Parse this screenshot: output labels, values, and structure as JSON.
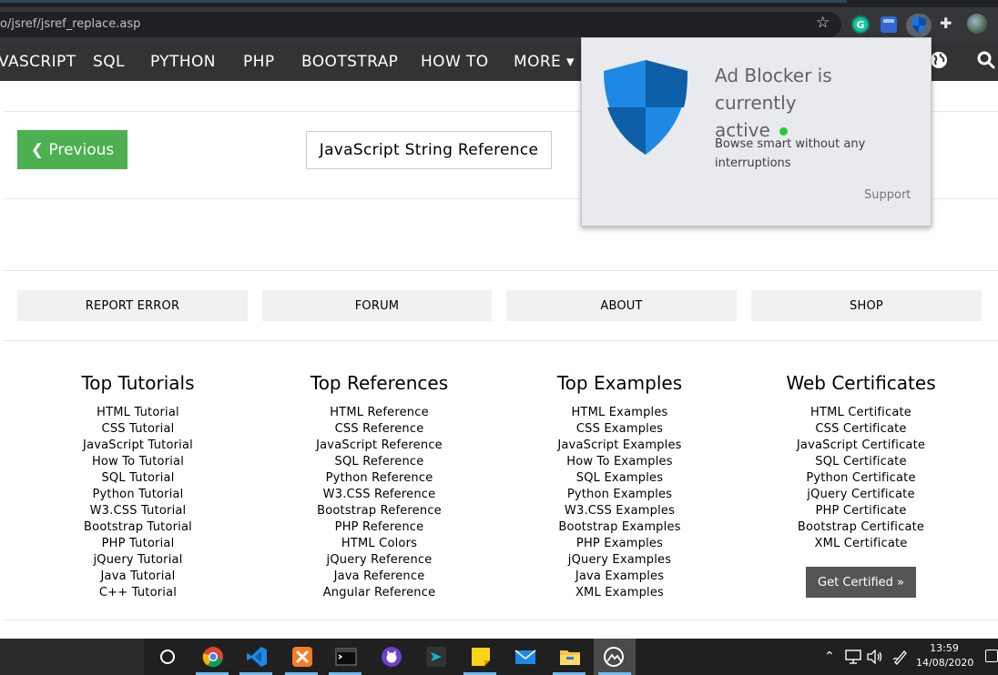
{
  "browser": {
    "url": "o/jsref/jsref_replace.asp"
  },
  "navbar": {
    "items": [
      "VASCRIPT",
      "SQL",
      "PYTHON",
      "PHP",
      "BOOTSTRAP",
      "HOW TO",
      "MORE ▾"
    ]
  },
  "page": {
    "previous_label": "❮ Previous",
    "reference_label": "JavaScript String Reference"
  },
  "footer_buttons": [
    "REPORT ERROR",
    "FORUM",
    "ABOUT",
    "SHOP"
  ],
  "columns": [
    {
      "title": "Top Tutorials",
      "links": [
        "HTML Tutorial",
        "CSS Tutorial",
        "JavaScript Tutorial",
        "How To Tutorial",
        "SQL Tutorial",
        "Python Tutorial",
        "W3.CSS Tutorial",
        "Bootstrap Tutorial",
        "PHP Tutorial",
        "jQuery Tutorial",
        "Java Tutorial",
        "C++ Tutorial"
      ]
    },
    {
      "title": "Top References",
      "links": [
        "HTML Reference",
        "CSS Reference",
        "JavaScript Reference",
        "SQL Reference",
        "Python Reference",
        "W3.CSS Reference",
        "Bootstrap Reference",
        "PHP Reference",
        "HTML Colors",
        "jQuery Reference",
        "Java Reference",
        "Angular Reference"
      ]
    },
    {
      "title": "Top Examples",
      "links": [
        "HTML Examples",
        "CSS Examples",
        "JavaScript Examples",
        "How To Examples",
        "SQL Examples",
        "Python Examples",
        "W3.CSS Examples",
        "Bootstrap Examples",
        "PHP Examples",
        "jQuery Examples",
        "Java Examples",
        "XML Examples"
      ]
    },
    {
      "title": "Web Certificates",
      "links": [
        "HTML Certificate",
        "CSS Certificate",
        "JavaScript Certificate",
        "SQL Certificate",
        "Python Certificate",
        "jQuery Certificate",
        "PHP Certificate",
        "Bootstrap Certificate",
        "XML Certificate"
      ],
      "cta": "Get Certified »"
    }
  ],
  "popup": {
    "title": "Ad Blocker is currently active",
    "title_line1": "Ad Blocker is currently",
    "title_line2": "active",
    "description": "Bowse smart without any interruptions",
    "support": "Support",
    "status_color": "#1ed12e"
  },
  "taskbar": {
    "time": "13:59",
    "date": "14/08/2020",
    "apps": [
      "start-circle-icon",
      "chrome-icon",
      "vscode-icon",
      "xampp-icon",
      "terminal-icon",
      "github-desktop-icon",
      "sublime-merge-icon",
      "sticky-notes-icon",
      "mail-icon",
      "file-explorer-icon",
      "photos-icon"
    ]
  },
  "colors": {
    "navbar": "#333333",
    "previous": "#4caf50",
    "footer_button": "#f1f1f1",
    "cert_button": "#555555"
  }
}
